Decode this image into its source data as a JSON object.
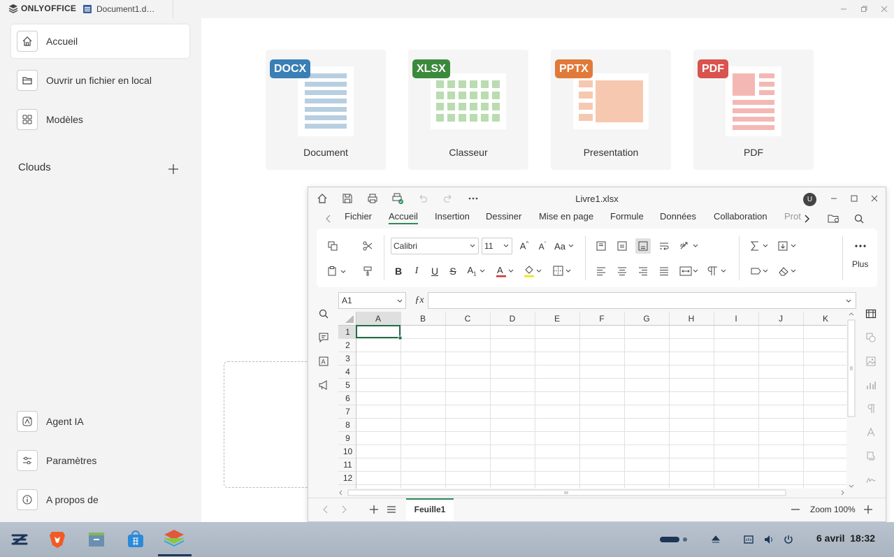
{
  "titlebar": {
    "brand": "ONLYOFFICE",
    "doc_tab": "Document1.d…"
  },
  "sidebar": {
    "items": [
      {
        "label": "Accueil",
        "icon": "home-icon"
      },
      {
        "label": "Ouvrir un fichier en local",
        "icon": "folder-icon"
      },
      {
        "label": "Modèles",
        "icon": "grid-icon"
      }
    ],
    "clouds_label": "Clouds",
    "bottom_items": [
      {
        "label": "Agent IA",
        "icon": "ai-agent-icon"
      },
      {
        "label": "Paramètres",
        "icon": "settings-sliders-icon"
      },
      {
        "label": "A propos de",
        "icon": "info-icon"
      }
    ]
  },
  "create_cards": [
    {
      "badge": "DOCX",
      "label": "Document",
      "color": "#3a7fb5"
    },
    {
      "badge": "XLSX",
      "label": "Classeur",
      "color": "#3b8a3b"
    },
    {
      "badge": "PPTX",
      "label": "Presentation",
      "color": "#e07a3a"
    },
    {
      "badge": "PDF",
      "label": "PDF",
      "color": "#d9534f"
    }
  ],
  "spreadsheet": {
    "filename": "Livre1.xlsx",
    "avatar": "U",
    "tabs": [
      "Fichier",
      "Accueil",
      "Insertion",
      "Dessiner",
      "Mise en page",
      "Formule",
      "Données",
      "Collaboration",
      "Prot"
    ],
    "active_tab": "Accueil",
    "font_name": "Calibri",
    "font_size": "11",
    "more_label": "Plus",
    "cell_ref": "A1",
    "columns": [
      "A",
      "B",
      "C",
      "D",
      "E",
      "F",
      "G",
      "H",
      "I",
      "J",
      "K"
    ],
    "rows": [
      "1",
      "2",
      "3",
      "4",
      "5",
      "6",
      "7",
      "8",
      "9",
      "10",
      "11",
      "12"
    ],
    "sheet_name": "Feuille1",
    "zoom": "Zoom 100%"
  },
  "taskbar": {
    "date": "6 avril",
    "time": "18:32"
  },
  "colors": {
    "accent_green": "#2e8b57",
    "docx": "#3a7fb5",
    "xlsx": "#3b8a3b",
    "pptx": "#e07a3a",
    "pdf": "#d9534f"
  }
}
